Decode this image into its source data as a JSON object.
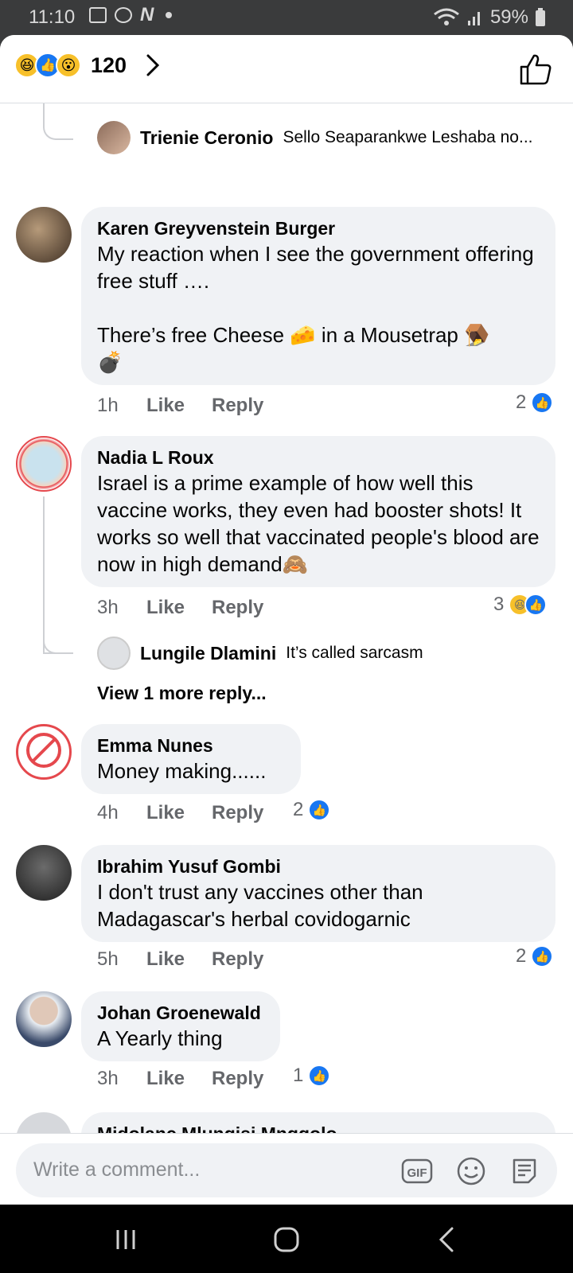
{
  "status_bar": {
    "time": "11:10",
    "battery": "59%"
  },
  "header": {
    "reaction_count": "120"
  },
  "comments": [
    {
      "reply": {
        "name": "Trienie Ceronio",
        "text": "Sello Seaparankwe Leshaba no..."
      }
    },
    {
      "author": "Karen Greyvenstein Burger",
      "text": "My reaction when I see the government offering free stuff ….\n\nThere’s free Cheese 🧀 in a Mousetrap 🪤\n💣",
      "time": "1h",
      "like": "Like",
      "reply": "Reply",
      "reactions": "2"
    },
    {
      "author": "Nadia L Roux",
      "text": "Israel is a prime example of how well this vaccine works, they even had booster shots! It works so well that vaccinated people's blood are now in high demand🙈",
      "time": "3h",
      "like": "Like",
      "reply": "Reply",
      "reactions": "3",
      "sub_reply": {
        "name": "Lungile Dlamini",
        "text": "It’s called sarcasm"
      },
      "view_more": "View 1 more reply..."
    },
    {
      "author": "Emma Nunes",
      "text": "Money making......",
      "time": "4h",
      "like": "Like",
      "reply": "Reply",
      "reactions": "2"
    },
    {
      "author": "Ibrahim Yusuf Gombi",
      "text": "I don't trust any vaccines other than Madagascar's herbal covidogarnic",
      "time": "5h",
      "like": "Like",
      "reply": "Reply",
      "reactions": "2"
    },
    {
      "author": "Johan Groenewald",
      "text": "A Yearly thing",
      "time": "3h",
      "like": "Like",
      "reply": "Reply",
      "reactions": "1"
    },
    {
      "author": "Midolanc Mlungisi Mngqolo"
    }
  ],
  "composer": {
    "placeholder": "Write a comment..."
  },
  "icons": [
    "haha-icon",
    "like-icon",
    "wow-icon",
    "chevron-right-icon",
    "like-outline-icon",
    "gif-icon",
    "emoji-icon",
    "sticker-icon",
    "recents-icon",
    "home-icon",
    "back-icon"
  ],
  "colors": {
    "accent": "#1877f2",
    "bubble": "#f0f2f5",
    "meta": "#65676b"
  }
}
